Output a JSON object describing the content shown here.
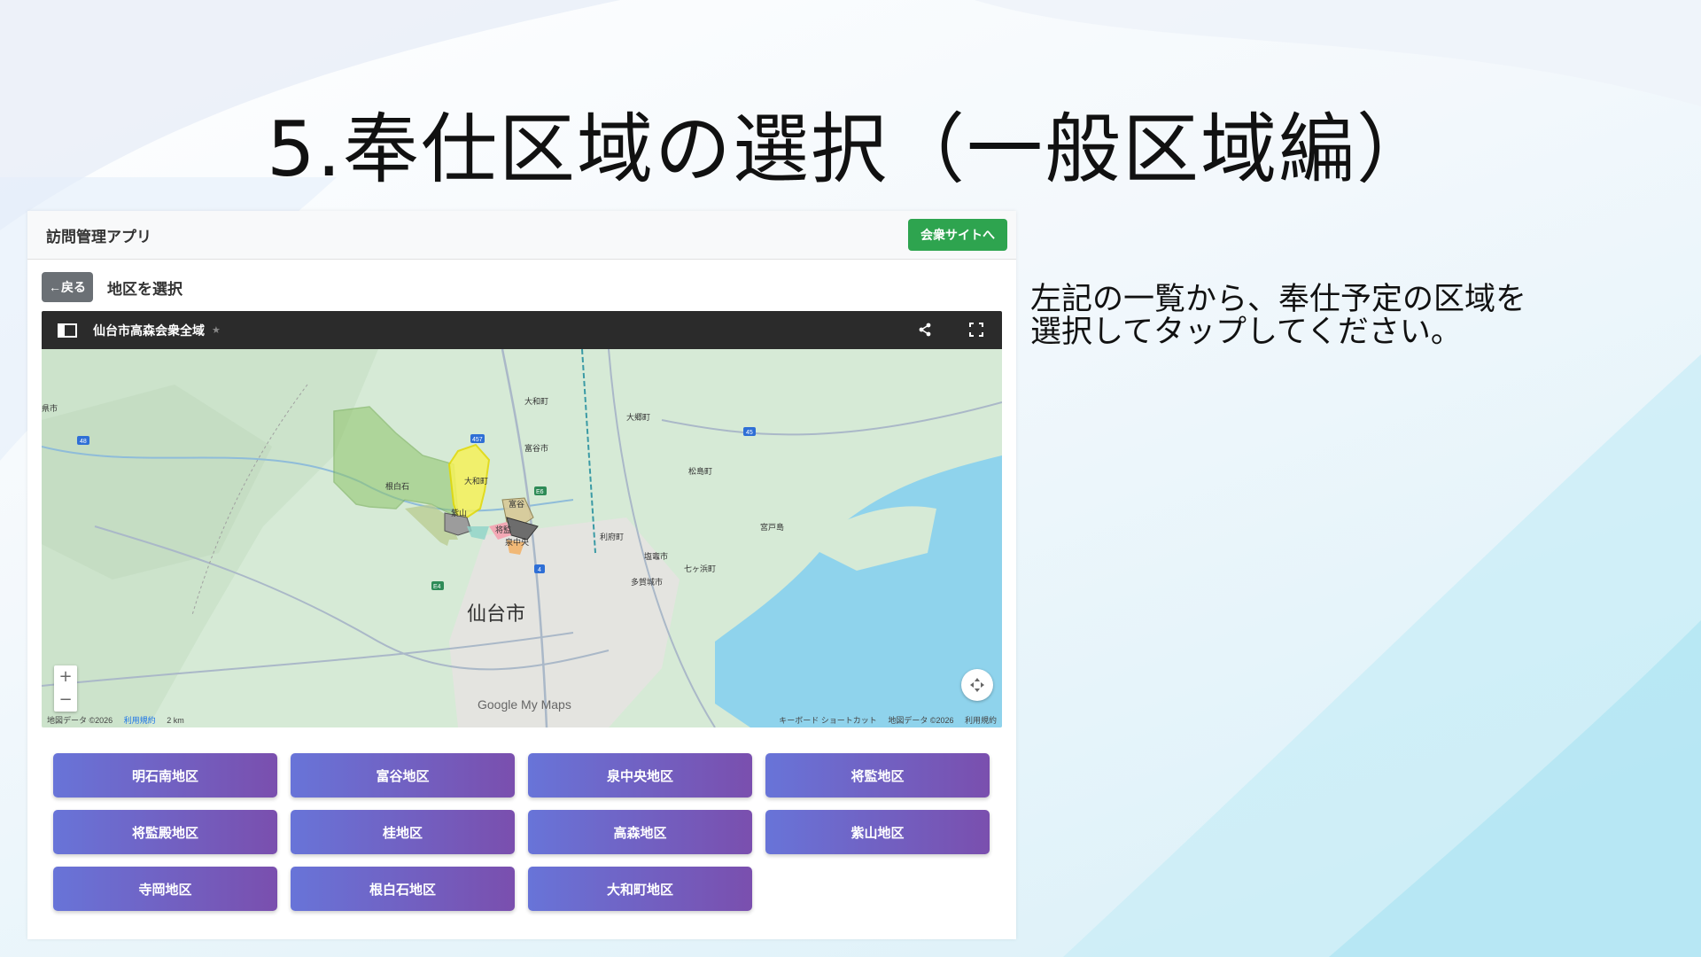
{
  "slide": {
    "title": "5.奉仕区域の選択（一般区域編）",
    "instruction_lines": [
      "左記の一覧から、奉仕予定の区域を",
      "選択してタップしてください。"
    ]
  },
  "app": {
    "title": "訪問管理アプリ",
    "congregation_site_label": "会衆サイトへ",
    "back_label": "←戻る",
    "page_title": "地区を選択"
  },
  "map": {
    "name": "仙台市高森会衆全域",
    "labels": {
      "sendai": "仙台市",
      "taiwa": "大和町",
      "taiwa2": "大和町",
      "tomiya": "富谷市",
      "ohira": "大郷町",
      "matsushima": "松島町",
      "rifu": "利府町",
      "shiogama": "塩竈市",
      "shichigahama": "七ヶ浜町",
      "tagajo": "多賀城市",
      "miyato": "宮戸島",
      "nebashiroishi": "根白石",
      "murayama": "紫山",
      "tomiya_short": "富谷",
      "shogen": "将監",
      "izumichuo": "泉中央",
      "edge_city": "県市"
    },
    "roads": [
      "457",
      "4",
      "45",
      "48",
      "E6",
      "E4"
    ],
    "footer_left": "地図データ ©2026",
    "footer_terms": "利用規約",
    "scale": "2 km",
    "footer_right_shortcut": "キーボード ショートカット",
    "footer_right_data": "地図データ ©2026",
    "footer_right_terms": "利用規約",
    "logo": "Google My Maps",
    "zoom_in": "+",
    "zoom_out": "−"
  },
  "districts": [
    "明石南地区",
    "富谷地区",
    "泉中央地区",
    "将監地区",
    "将監殿地区",
    "桂地区",
    "高森地区",
    "紫山地区",
    "寺岡地区",
    "根白石地区",
    "大和町地区"
  ],
  "colors": {
    "congregation_button": "#2ea44f",
    "back_button": "#6b7075",
    "district_gradient_start": "#6874d8",
    "district_gradient_end": "#7a4fae",
    "map_land": "#d6ead6",
    "map_sea": "#8fd3ec"
  }
}
